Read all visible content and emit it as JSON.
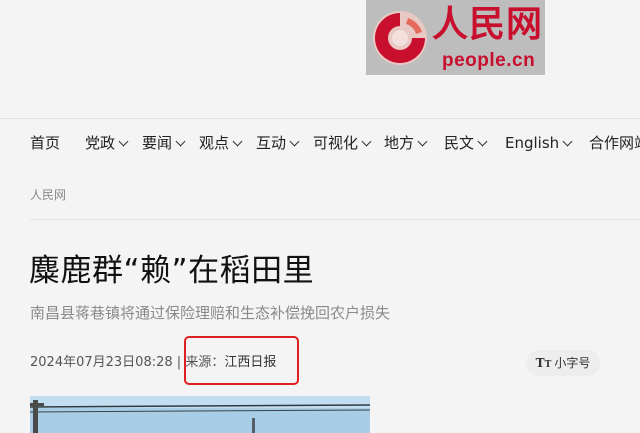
{
  "logo": {
    "cn": "人民网",
    "en": "people.cn"
  },
  "nav": {
    "items": [
      {
        "label": "首页",
        "dropdown": false
      },
      {
        "label": "党政",
        "dropdown": true
      },
      {
        "label": "要闻",
        "dropdown": true
      },
      {
        "label": "观点",
        "dropdown": true
      },
      {
        "label": "互动",
        "dropdown": true
      },
      {
        "label": "可视化",
        "dropdown": true
      },
      {
        "label": "地方",
        "dropdown": true
      },
      {
        "label": "民文",
        "dropdown": true
      },
      {
        "label": "English",
        "dropdown": true
      },
      {
        "label": "合作网站",
        "dropdown": false
      }
    ]
  },
  "breadcrumb": "人民网",
  "article": {
    "title": "麋鹿群“赖”在稻田里",
    "subtitle": "南昌县蒋巷镇将通过保险理赔和生态补偿挽回农户损失",
    "datetime": "2024年07月23日08:28",
    "separator": "|",
    "source_label": "来源：",
    "source_name": "江西日报"
  },
  "font_toggle": {
    "icon": "text-size-icon",
    "label": "小字号"
  },
  "colors": {
    "brand_red": "#c8102e",
    "highlight_red": "#e02020"
  }
}
